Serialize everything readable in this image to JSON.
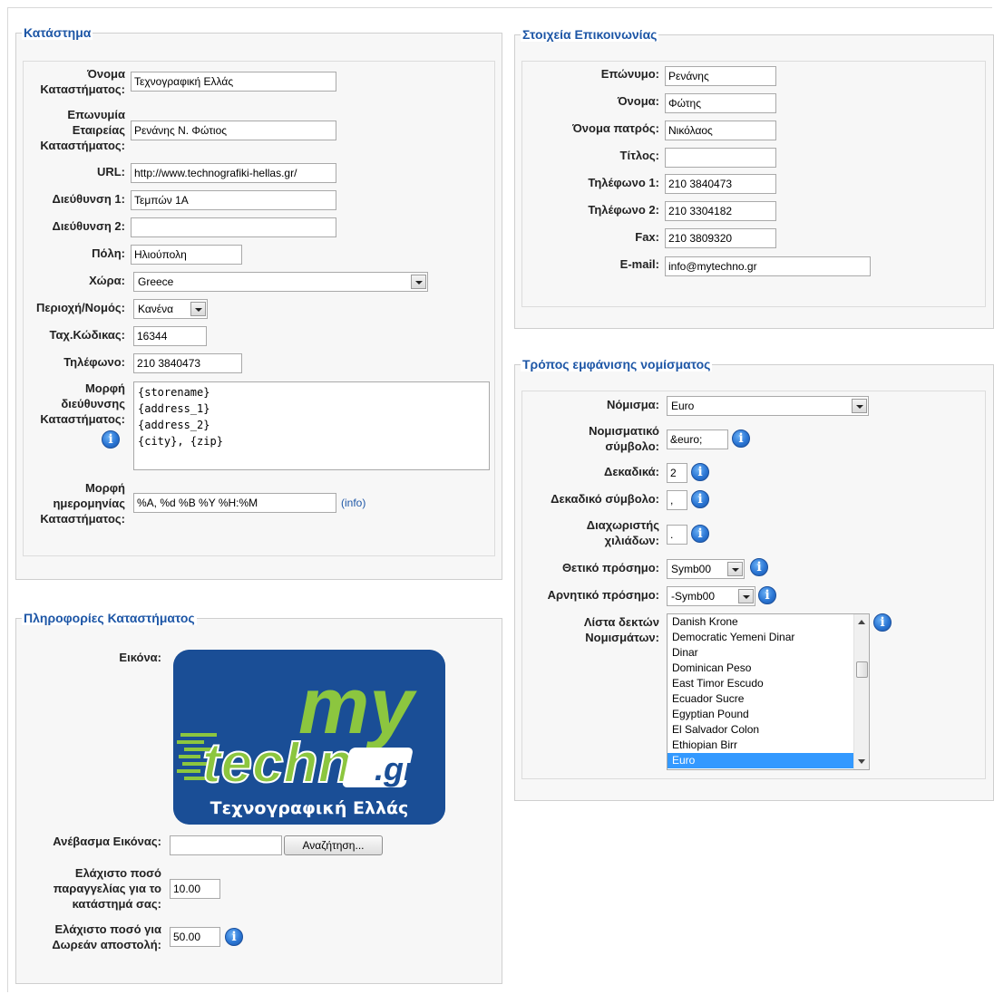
{
  "store": {
    "legend": "Κατάστημα",
    "name_label_1": "Όνομα",
    "name_label_2": "Καταστήματος:",
    "name_value": "Τεχνογραφική Ελλάς",
    "company_label_1": "Επωνυμία",
    "company_label_2": "Εταιρείας",
    "company_label_3": "Καταστήματος:",
    "company_value": "Ρενάνης Ν. Φώτιος",
    "url_label": "URL:",
    "url_value": "http://www.technografiki-hellas.gr/",
    "address1_label": "Διεύθυνση 1:",
    "address1_value": "Τεμπών 1Α",
    "address2_label": "Διεύθυνση 2:",
    "address2_value": "",
    "city_label": "Πόλη:",
    "city_value": "Ηλιούπολη",
    "country_label": "Χώρα:",
    "country_value": "Greece",
    "region_label": "Περιοχή/Νομός:",
    "region_value": "Κανένα",
    "zip_label": "Ταχ.Κώδικας:",
    "zip_value": "16344",
    "phone_label": "Τηλέφωνο:",
    "phone_value": "210 3840473",
    "addrformat_label_1": "Μορφή",
    "addrformat_label_2": "διεύθυνσης",
    "addrformat_label_3": "Καταστήματος:",
    "addrformat_value": "{storename}\n{address_1}\n{address_2}\n{city}, {zip}",
    "dateformat_label_1": "Μορφή",
    "dateformat_label_2": "ημερομηνίας",
    "dateformat_label_3": "Καταστήματος:",
    "dateformat_value": "%A, %d %B %Y %H:%M",
    "dateformat_info": "(info)"
  },
  "storeinfo": {
    "legend": "Πληροφορίες Καταστήματος",
    "image_label": "Εικόνα:",
    "logo_text_my": "my",
    "logo_text_techno": "techno",
    "logo_text_gr": ".gr",
    "logo_caption": "Τεχνογραφική Ελλάς",
    "upload_label": "Ανέβασμα Εικόνας:",
    "browse_button": "Αναζήτηση...",
    "minorder_label_1": "Ελάχιστο ποσό",
    "minorder_label_2": "παραγγελίας για το",
    "minorder_label_3": "κατάστημά σας:",
    "minorder_value": "10.00",
    "freeship_label_1": "Ελάχιστο ποσό για",
    "freeship_label_2": "Δωρεάν αποστολή:",
    "freeship_value": "50.00"
  },
  "contact": {
    "legend": "Στοιχεία Επικοινωνίας",
    "surname_label": "Επώνυμο:",
    "surname_value": "Ρενάνης",
    "firstname_label": "Όνομα:",
    "firstname_value": "Φώτης",
    "father_label": "Όνομα πατρός:",
    "father_value": "Νικόλαος",
    "title_label": "Τίτλος:",
    "title_value": "",
    "phone1_label": "Τηλέφωνο 1:",
    "phone1_value": "210 3840473",
    "phone2_label": "Τηλέφωνο 2:",
    "phone2_value": "210 3304182",
    "fax_label": "Fax:",
    "fax_value": "210 3809320",
    "email_label": "E-mail:",
    "email_value": "info@mytechno.gr"
  },
  "currency": {
    "legend": "Τρόπος εμφάνισης νομίσματος",
    "currency_label": "Νόμισμα:",
    "currency_value": "Euro",
    "symbol_label_1": "Νομισματικό",
    "symbol_label_2": "σύμβολο:",
    "symbol_value": "&euro;",
    "decimals_label": "Δεκαδικά:",
    "decimals_value": "2",
    "decsymbol_label": "Δεκαδικό σύμβολο:",
    "decsymbol_value": ",",
    "thousands_label_1": "Διαχωριστής",
    "thousands_label_2": "χιλιάδων:",
    "thousands_value": ".",
    "positive_label": "Θετικό πρόσημο:",
    "positive_value": "Symb00",
    "negative_label": "Αρνητικό πρόσημο:",
    "negative_value": "-Symb00",
    "accepted_label_1": "Λίστα δεκτών",
    "accepted_label_2": "Νομισμάτων:",
    "accepted_items": [
      "Danish Krone",
      "Democratic Yemeni Dinar",
      "Dinar",
      "Dominican Peso",
      "East Timor Escudo",
      "Ecuador Sucre",
      "Egyptian Pound",
      "El Salvador Colon",
      "Ethiopian Birr",
      "Euro"
    ],
    "accepted_selected": "Euro"
  },
  "icons": {
    "info": "info-icon",
    "dropdown": "chevron-down-icon"
  },
  "colors": {
    "legend": "#1d56a6",
    "selection": "#3399ff",
    "logo_bg": "#1a4e96",
    "logo_green": "#8cc63f"
  }
}
